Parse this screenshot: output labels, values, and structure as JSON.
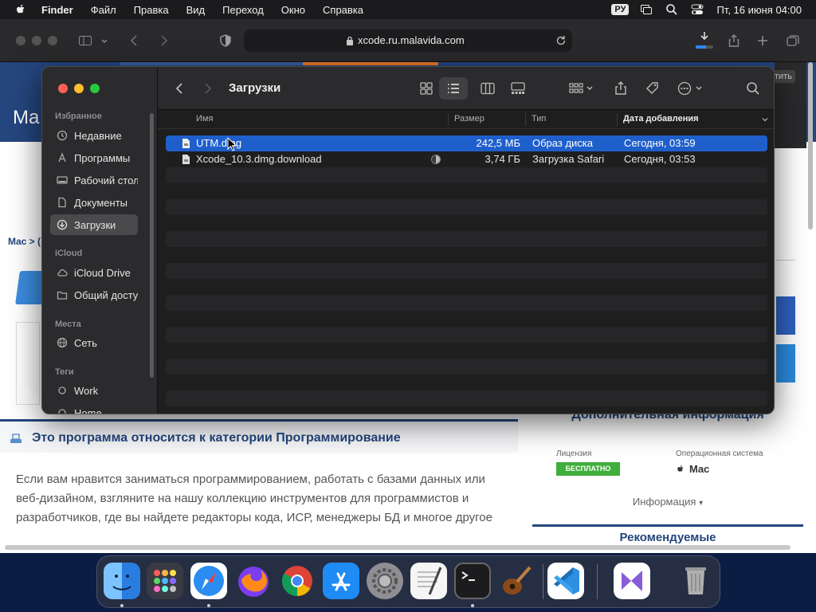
{
  "menubar": {
    "app_name": "Finder",
    "menus": [
      "Файл",
      "Правка",
      "Вид",
      "Переход",
      "Окно",
      "Справка"
    ],
    "input_language": "РУ",
    "clock": "Пт, 16 июня  04:00",
    "icons": [
      "apple-icon",
      "screen-mirroring-icon",
      "search-icon",
      "control-center-icon"
    ]
  },
  "safari": {
    "url": "xcode.ru.malavida.com",
    "download_progress": 0.6,
    "icons": [
      "sidebar-icon",
      "back-icon",
      "forward-icon",
      "shield-icon",
      "lock-icon",
      "reload-icon",
      "downloads-icon",
      "share-icon",
      "new-tab-icon",
      "tabs-overview-icon"
    ]
  },
  "webpage": {
    "logo_partial": "Ma",
    "breadcrumb_partial": "Mac > (",
    "right_button_partial": "тить",
    "category_title": "Это программа относится к категории Программирование",
    "description": "Если вам нравится заниматься программированием, работать с базами данных или веб-дизайном, взгляните на нашу коллекцию инструментов для программистов и разработчиков, где вы найдете редакторы кода, ИСР, менеджеры БД и многое другое",
    "extra_info_title": "Дополнительная информация",
    "license_label": "Лицензия",
    "license_value": "БЕСПЛАТНО",
    "os_label": "Операционная система",
    "os_value": "Mac",
    "info_link": "Информация",
    "recommended": "Рекомендуемые"
  },
  "finder": {
    "title": "Загрузки",
    "sidebar": {
      "sections": [
        {
          "title": "Избранное",
          "items": [
            {
              "label": "Недавние",
              "icon": "clock-icon"
            },
            {
              "label": "Программы",
              "icon": "applications-icon"
            },
            {
              "label": "Рабочий стол",
              "icon": "desktop-icon"
            },
            {
              "label": "Документы",
              "icon": "document-icon"
            },
            {
              "label": "Загрузки",
              "icon": "downloads-icon",
              "selected": true
            }
          ]
        },
        {
          "title": "iCloud",
          "items": [
            {
              "label": "iCloud Drive",
              "icon": "cloud-icon"
            },
            {
              "label": "Общий доступ",
              "icon": "shared-folder-icon"
            }
          ]
        },
        {
          "title": "Места",
          "items": [
            {
              "label": "Сеть",
              "icon": "globe-icon"
            }
          ]
        },
        {
          "title": "Теги",
          "items": [
            {
              "label": "Work",
              "icon": "tag-circle-icon"
            },
            {
              "label": "Home",
              "icon": "tag-circle-icon"
            }
          ]
        }
      ]
    },
    "columns": {
      "name": "Имя",
      "size": "Размер",
      "kind": "Тип",
      "date_added": "Дата добавления"
    },
    "files": [
      {
        "name": "UTM.dmg",
        "size": "242,5 МБ",
        "kind": "Образ диска",
        "date_added": "Сегодня, 03:59",
        "selected": true
      },
      {
        "name": "Xcode_10.3.dmg.download",
        "size": "3,74 ГБ",
        "kind": "Загрузка Safari",
        "date_added": "Сегодня, 03:53",
        "progress": 0.5
      }
    ],
    "toolbar_icons": [
      "back-icon",
      "forward-icon",
      "icon-view-icon",
      "list-view-icon",
      "column-view-icon",
      "gallery-view-icon",
      "group-icon",
      "share-icon",
      "tag-icon",
      "more-icon",
      "search-icon"
    ]
  },
  "dock": {
    "apps": [
      "Finder",
      "Launchpad",
      "Safari",
      "Firefox",
      "Chrome",
      "App Store",
      "System Preferences",
      "TextEdit",
      "Terminal",
      "Instruments",
      "Visual Studio Code",
      "Visual Studio",
      "Trash"
    ],
    "colors": {
      "finder": "#3b8ef0",
      "safari": "#2b8df2",
      "firefox": "#ff6a1a",
      "vscode": "#2c8fe0",
      "appstore": "#1f8bf5",
      "vs": "#8a5bd6"
    }
  }
}
